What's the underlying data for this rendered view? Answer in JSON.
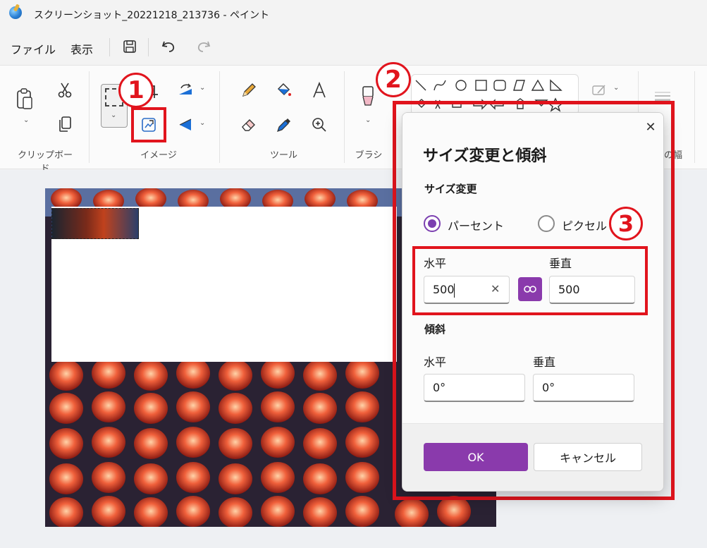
{
  "window": {
    "title": "スクリーンショット_20221218_213736 - ペイント"
  },
  "menu": {
    "file": "ファイル",
    "view": "表示"
  },
  "ribbon": {
    "groups": {
      "clipboard": "クリップボード",
      "image": "イメージ",
      "tools": "ツール",
      "brush": "ブラシ",
      "partial": "の幅"
    }
  },
  "annotations": {
    "step1": "1",
    "step2": "2",
    "step3": "3",
    "accent": "#e1141d"
  },
  "dialog": {
    "title": "サイズ変更と傾斜",
    "resize_section": "サイズ変更",
    "percent_label": "パーセント",
    "pixel_label": "ピクセル",
    "selected_mode": "パーセント",
    "horizontal_label": "水平",
    "vertical_label": "垂直",
    "horizontal_value": "500",
    "vertical_value": "500",
    "skew_section": "傾斜",
    "skew_horizontal_label": "水平",
    "skew_vertical_label": "垂直",
    "skew_horizontal_value": "0°",
    "skew_vertical_value": "0°",
    "ok": "OK",
    "cancel": "キャンセル",
    "accent": "#8a3aac"
  }
}
